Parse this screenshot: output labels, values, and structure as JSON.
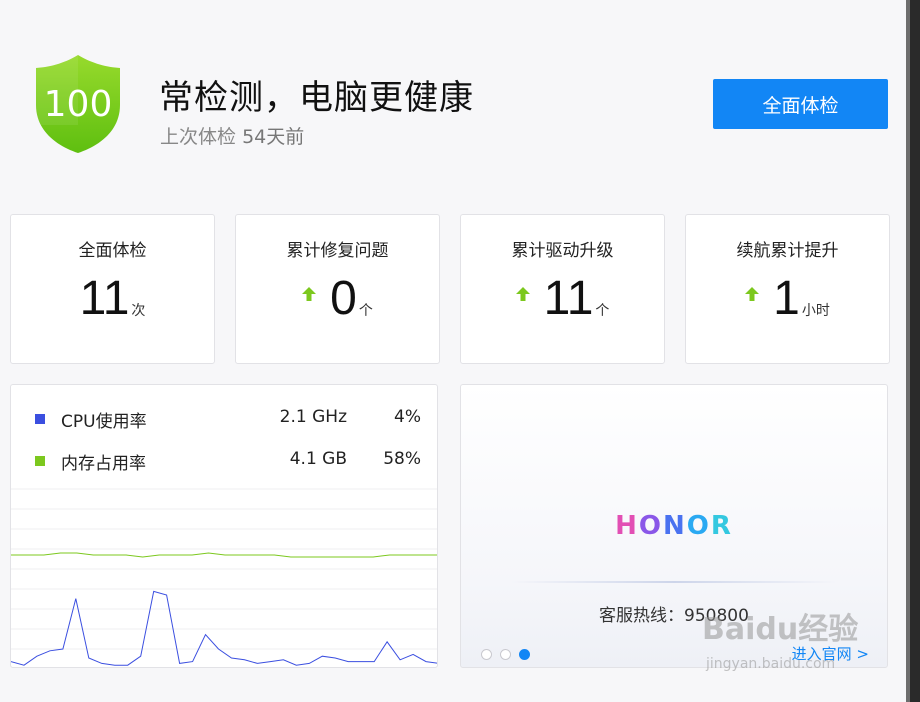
{
  "header": {
    "score": "100",
    "title": "常检测，电脑更健康",
    "subtitle_prefix": "上次体检",
    "subtitle_days": "54天前",
    "checkup_button": "全面体检"
  },
  "stats": [
    {
      "label": "全面体检",
      "value": "11",
      "unit": "次",
      "arrow": false
    },
    {
      "label": "累计修复问题",
      "value": "0",
      "unit": "个",
      "arrow": true
    },
    {
      "label": "累计驱动升级",
      "value": "11",
      "unit": "个",
      "arrow": true
    },
    {
      "label": "续航累计提升",
      "value": "1",
      "unit": "小时",
      "arrow": true
    }
  ],
  "monitor": {
    "cpu": {
      "label": "CPU使用率",
      "freq": "2.1 GHz",
      "percent": "4%",
      "color": "#3b4fe0"
    },
    "memory": {
      "label": "内存占用率",
      "size": "4.1 GB",
      "percent": "58%",
      "color": "#7cc81e"
    },
    "cpu_history": [
      3,
      1,
      6,
      9,
      10,
      38,
      5,
      2,
      1,
      1,
      6,
      42,
      40,
      2,
      3,
      18,
      10,
      5,
      4,
      2,
      3,
      4,
      1,
      2,
      6,
      5,
      3,
      3,
      3,
      14,
      4,
      7,
      3,
      2
    ],
    "memory_history": [
      58,
      58,
      58,
      59,
      59,
      58,
      58,
      58,
      57,
      58,
      58,
      58,
      59,
      58,
      58,
      58,
      58,
      57,
      57,
      57,
      57,
      57,
      57,
      58,
      58,
      58,
      58
    ]
  },
  "promo": {
    "brand": "HONOR",
    "hotline": "客服热线：950800",
    "link": "进入官网 >",
    "slide_count": 3,
    "active_slide": 3
  },
  "watermark": {
    "main": "Baidu经验",
    "sub": "jingyan.baidu.com"
  },
  "colors": {
    "accent": "#1286f5",
    "up_arrow": "#7cc81e",
    "shield_top": "#8fd428",
    "shield_bottom": "#5cbf12"
  }
}
